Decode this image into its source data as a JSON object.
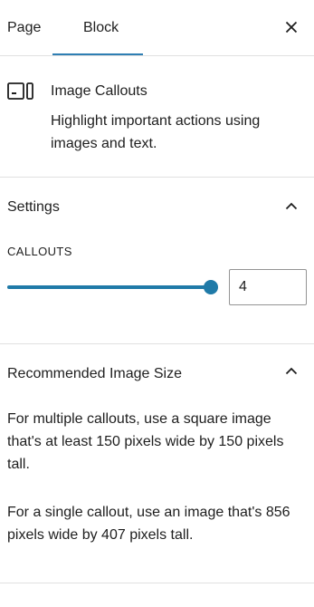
{
  "tabs": [
    {
      "label": "Page",
      "active": false
    },
    {
      "label": "Block",
      "active": true
    }
  ],
  "header": {
    "close_icon": "close-icon"
  },
  "block": {
    "icon": "image-callouts-icon",
    "title": "Image Callouts",
    "description": "Highlight important actions using images and text."
  },
  "settings": {
    "title": "Settings",
    "expanded": true,
    "callouts_label": "CALLOUTS",
    "callouts_value": "4",
    "slider_fraction": 1.0
  },
  "image_size": {
    "title": "Recommended Image Size",
    "expanded": true,
    "paragraphs": [
      "For multiple callouts, use a square image that's at least 150 pixels wide by 150 pixels tall.",
      "For a single callout, use an image that's 856 pixels wide by 407 pixels tall."
    ]
  },
  "colors": {
    "accent": "#1f7aa8",
    "tab_underline": "#2f7fb3",
    "divider": "#e0e0e0",
    "text": "#1e1e1e"
  }
}
